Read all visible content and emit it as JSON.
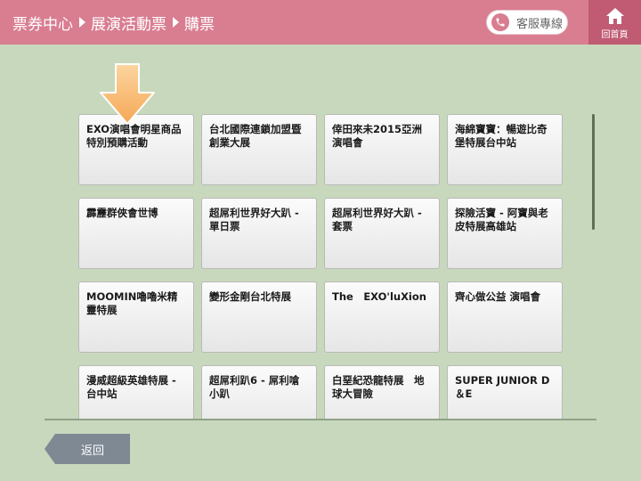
{
  "header": {
    "breadcrumb": [
      "票券中心",
      "展演活動票",
      "購票"
    ],
    "service_label": "客服專線",
    "home_label": "回首頁"
  },
  "events": [
    "EXO演唱會明星商品特別預購活動",
    "台北國際連鎖加盟暨創業大展",
    "倖田來未2015亞洲演唱會",
    "海綿寶寶：暢遊比奇堡特展台中站",
    "霹靂群俠會世博",
    "超屌利世界好大趴 - 單日票",
    "超屌利世界好大趴 - 套票",
    "探險活寶 - 阿寶與老皮特展高雄站",
    "MOOMIN嚕嚕米精靈特展",
    "變形金剛台北特展",
    "The　EXO'luXion",
    "齊心做公益 演唱會",
    "漫威超級英雄特展 - 台中站",
    "超屌利趴6 - 屌利嗆小趴",
    "白堊紀恐龍特展　地球大冒險",
    "SUPER JUNIOR D＆E"
  ],
  "footer": {
    "back_label": "返回"
  },
  "colors": {
    "header_bg": "#d97d91",
    "home_bg": "#c05b73",
    "page_bg": "#c8d8bd",
    "pointer": "#f9b96c"
  },
  "icons": {
    "phone": "phone-icon",
    "home": "home-icon",
    "pointer": "down-arrow-icon"
  }
}
